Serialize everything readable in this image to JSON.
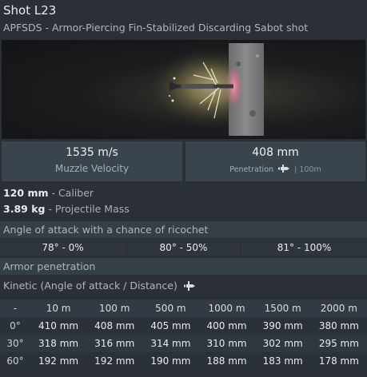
{
  "header": {
    "title": "Shot L23",
    "subtitle": "APFSDS - Armor-Piercing Fin-Stabilized Discarding Sabot shot"
  },
  "stats": {
    "muzzle_velocity": {
      "value": "1535 m/s",
      "label": "Muzzle Velocity"
    },
    "penetration": {
      "value": "408 mm",
      "label": "Penetration",
      "distance": "| 100m"
    }
  },
  "properties": {
    "caliber": {
      "value": "120 mm",
      "label": " - Caliber"
    },
    "mass": {
      "value": "3.89 kg",
      "label": " - Projectile Mass"
    }
  },
  "ricochet": {
    "header": "Angle of attack with a chance of ricochet",
    "cells": [
      "78° - 0%",
      "80° - 50%",
      "81° - 100%"
    ]
  },
  "armor": {
    "header": "Armor penetration",
    "kinetic_label": "Kinetic (Angle of attack / Distance)",
    "corner": "-",
    "columns": [
      "10 m",
      "100 m",
      "500 m",
      "1000 m",
      "1500 m",
      "2000 m"
    ],
    "rows": [
      {
        "angle": "0°",
        "values": [
          "410 mm",
          "408 mm",
          "405 mm",
          "400 mm",
          "390 mm",
          "380 mm"
        ]
      },
      {
        "angle": "30°",
        "values": [
          "318 mm",
          "316 mm",
          "314 mm",
          "310 mm",
          "302 mm",
          "295 mm"
        ]
      },
      {
        "angle": "60°",
        "values": [
          "192 mm",
          "192 mm",
          "190 mm",
          "188 mm",
          "183 mm",
          "178 mm"
        ]
      }
    ]
  },
  "icons": {
    "penetration": "shell-icon",
    "kinetic": "shell-icon"
  }
}
